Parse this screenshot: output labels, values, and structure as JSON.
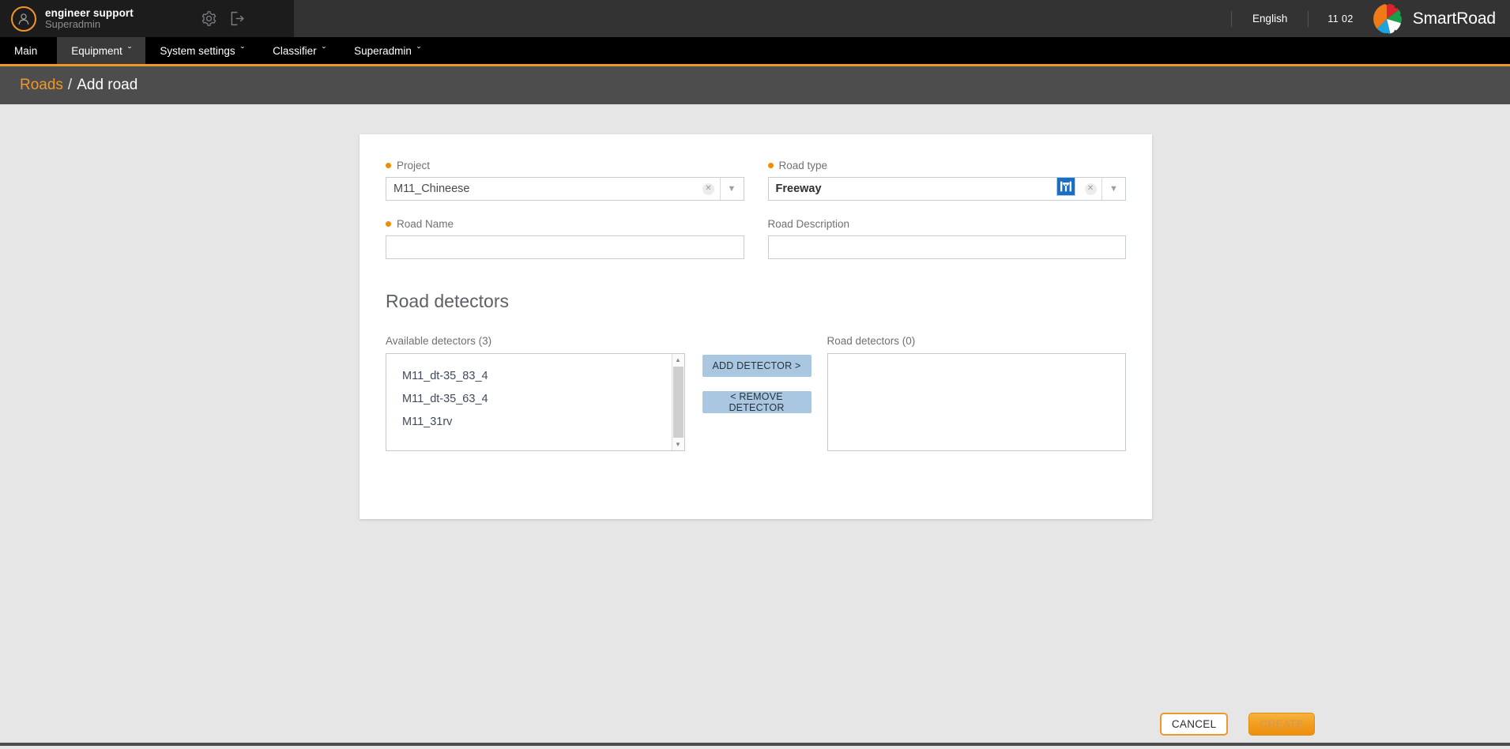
{
  "header": {
    "user_name": "engineer support",
    "user_role": "Superadmin",
    "settings_icon": "gear-icon",
    "logout_icon": "logout-icon",
    "avatar_icon": "user-avatar-icon",
    "language": "English",
    "clock": "11 02",
    "brand": "SmartRoad",
    "logo_icon": "smartroad-gear-logo",
    "colors": {
      "accent": "#f0972a",
      "topbar_bg": "#333333",
      "user_block_bg": "#1c1c1c",
      "nav_bg": "#000000",
      "nav_active_bg": "#3a3a3a",
      "crumb_bg": "#4d4d4d"
    }
  },
  "nav": {
    "items": [
      {
        "label": "Main",
        "caret": "",
        "active": false
      },
      {
        "label": "Equipment",
        "caret": "ˇ",
        "active": true
      },
      {
        "label": "System settings",
        "caret": "ˇ",
        "active": false
      },
      {
        "label": "Classifier",
        "caret": "ˇ",
        "active": false
      },
      {
        "label": "Superadmin",
        "caret": "ˇ",
        "active": false
      }
    ]
  },
  "breadcrumb": {
    "parent": "Roads",
    "separator": "/",
    "current": "Add road"
  },
  "form": {
    "project": {
      "label": "Project",
      "required": true,
      "value": "M11_Chineese",
      "clear_icon": "clear-x-icon",
      "chevron_icon": "chevron-down-icon"
    },
    "road_type": {
      "label": "Road type",
      "required": true,
      "value": "Freeway",
      "sign_icon": "motorway-sign-icon",
      "sign_color": "#1a6fc4",
      "clear_icon": "clear-x-icon",
      "chevron_icon": "chevron-down-icon"
    },
    "road_name": {
      "label": "Road Name",
      "required": true,
      "value": "",
      "placeholder": ""
    },
    "road_description": {
      "label": "Road Description",
      "required": false,
      "value": "",
      "placeholder": ""
    }
  },
  "detectors": {
    "section_title": "Road detectors",
    "available": {
      "caption": "Available detectors (3)",
      "items": [
        "M11_dt-35_83_4",
        "M11_dt-35_63_4",
        "M11_31rv"
      ]
    },
    "assigned": {
      "caption": "Road detectors (0)",
      "items": []
    },
    "add_label": "ADD DETECTOR >",
    "remove_label": "< REMOVE DETECTOR",
    "button_color": "#a9c7e0",
    "scroll_up_icon": "scroll-up-arrow-icon",
    "scroll_down_icon": "scroll-down-arrow-icon"
  },
  "footer": {
    "cancel_label": "CANCEL",
    "create_label": "CREATE",
    "create_disabled": true
  }
}
